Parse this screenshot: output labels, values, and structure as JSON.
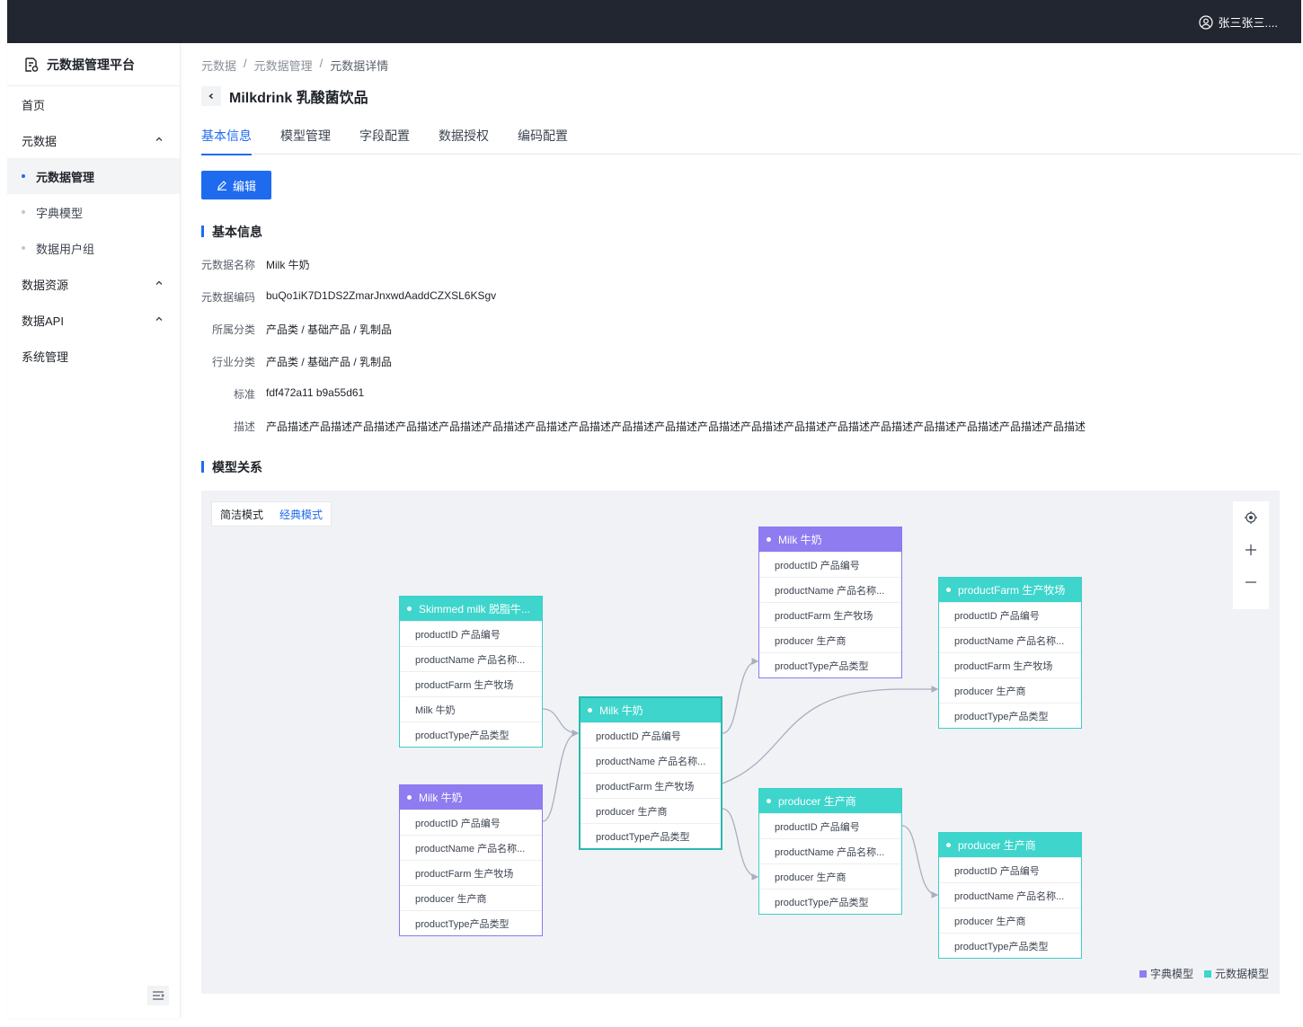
{
  "header": {
    "username": "张三张三...."
  },
  "sidebar": {
    "brand": "元数据管理平台",
    "items": [
      {
        "label": "首页"
      },
      {
        "label": "元数据"
      },
      {
        "label": "元数据管理"
      },
      {
        "label": "字典模型"
      },
      {
        "label": "数据用户组"
      },
      {
        "label": "数据资源"
      },
      {
        "label": "数据API"
      },
      {
        "label": "系统管理"
      }
    ]
  },
  "breadcrumb": [
    "元数据",
    "元数据管理",
    "元数据详情"
  ],
  "page": {
    "title": "Milkdrink 乳酸菌饮品"
  },
  "tabs": [
    "基本信息",
    "模型管理",
    "字段配置",
    "数据授权",
    "编码配置"
  ],
  "edit_button": "编辑",
  "basic_info": {
    "section_title": "基本信息",
    "rows": [
      {
        "label": "元数据名称",
        "value": "Milk 牛奶"
      },
      {
        "label": "元数据编码",
        "value": "buQo1iK7D1DS2ZmarJnxwdAaddCZXSL6KSgv"
      },
      {
        "label": "所属分类",
        "value": "产品类 / 基础产品 / 乳制品"
      },
      {
        "label": "行业分类",
        "value": "产品类 / 基础产品 / 乳制品"
      },
      {
        "label": "标准",
        "value": "fdf472a11 b9a55d61"
      },
      {
        "label": "描述",
        "value": "产品描述产品描述产品描述产品描述产品描述产品描述产品描述产品描述产品描述产品描述产品描述产品描述产品描述产品描述产品描述产品描述产品描述产品描述产品描述"
      }
    ]
  },
  "model_relation": {
    "section_title": "模型关系",
    "modes": {
      "simple": "简洁模式",
      "classic": "经典模式"
    },
    "legend": {
      "dict": "字典模型",
      "meta": "元数据模型"
    },
    "colors": {
      "dict": "#8f7cf0",
      "meta": "#3dd5cc",
      "accent": "#1f6bf0"
    },
    "nodes": [
      {
        "title": "Skimmed milk 脱脂牛...",
        "kind": "meta",
        "fields": [
          "productID 产品编号",
          "productName 产品名称...",
          "productFarm 生产牧场",
          "Milk 牛奶",
          "productType产品类型"
        ]
      },
      {
        "title": "Milk 牛奶",
        "kind": "dict",
        "fields": [
          "productID 产品编号",
          "productName 产品名称...",
          "productFarm 生产牧场",
          "producer 生产商",
          "productType产品类型"
        ]
      },
      {
        "title": "Milk 牛奶",
        "kind": "meta",
        "fields": [
          "productID 产品编号",
          "productName 产品名称...",
          "productFarm 生产牧场",
          "producer 生产商",
          "productType产品类型"
        ]
      },
      {
        "title": "Milk 牛奶",
        "kind": "dict",
        "fields": [
          "productID 产品编号",
          "productName 产品名称...",
          "productFarm 生产牧场",
          "producer 生产商",
          "productType产品类型"
        ]
      },
      {
        "title": "producer 生产商",
        "kind": "meta",
        "fields": [
          "productID 产品编号",
          "productName 产品名称...",
          "producer 生产商",
          "productType产品类型"
        ]
      },
      {
        "title": "productFarm 生产牧场",
        "kind": "meta",
        "fields": [
          "productID 产品编号",
          "productName 产品名称...",
          "productFarm 生产牧场",
          "producer 生产商",
          "productType产品类型"
        ]
      },
      {
        "title": "producer 生产商",
        "kind": "meta",
        "fields": [
          "productID 产品编号",
          "productName 产品名称...",
          "producer 生产商",
          "productType产品类型"
        ]
      }
    ]
  }
}
